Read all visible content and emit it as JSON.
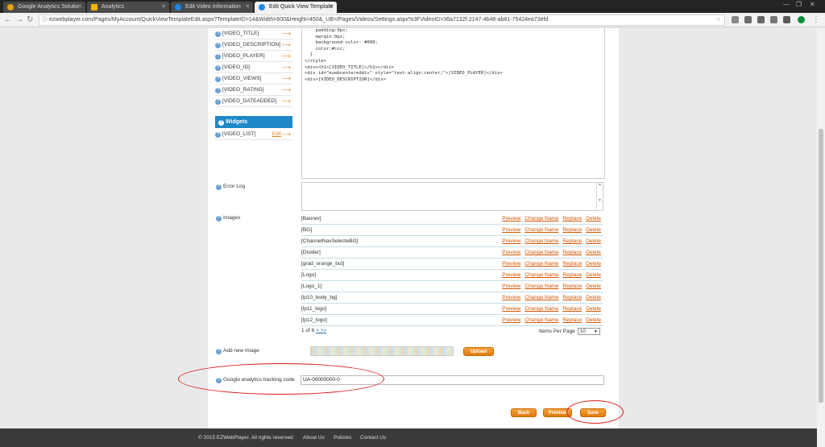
{
  "browser": {
    "tabs": [
      {
        "title": "Google Analytics Solutio",
        "color": "#e8a317"
      },
      {
        "title": "Analytics",
        "color": "#f4b400"
      },
      {
        "title": "Edit Video Information",
        "color": "#1e88e5"
      },
      {
        "title": "Edit Quick View Template",
        "color": "#1e88e5"
      }
    ],
    "url": "ezwebplayer.com/Pages/MyAccount/QuickViewTemplateEdit.aspx?TemplateID=14&Width=600&Height=450&_UB=/Pages/Videos/Settings.aspx%3FVideoID=36a7132f-2147-4b48-ab81-75424ea73efd"
  },
  "fields": [
    "[VIDEO_TITLE]",
    "[VIDEO_DESCRIPTION]",
    "[VIDEO_PLAYER]",
    "[VIDEO_ID]",
    "[VIDEO_VIEWS]",
    "[VIDEO_RATING]",
    "[VIDEO_DATEADDED]"
  ],
  "widgets": {
    "header": "Widgets",
    "item": "[VIDEO_LIST]",
    "edit": "Edit"
  },
  "code": "    padding:0px;\n    margin:0px;\n    background-color: #000;\n    color:#ccc;\n  }\n</style>\n<div><h1>[VIDEO_TITLE]</h1></div>\n<div id=\"ezwbcentereddiv\" style=\"text-align:center;\">[VIDEO_PLAYER]</div>\n<div>[VIDEO_DESCRIPTION]</div>",
  "labels": {
    "error_log": "Error Log",
    "images": "Images",
    "add_new_image": "Add new image",
    "ga_code": "Google analytics tracking code"
  },
  "images": [
    "[Banner]",
    "[BG]",
    "[ChannelNavSelecteBG]",
    "[Divider]",
    "[grad_orange_but]",
    "[Logo]",
    "[Logo_1]",
    "[lp10_body_bg]",
    "[lp11_logo]",
    "[lp12_logo]"
  ],
  "image_actions": [
    "Preview",
    "Change Name",
    "Replace",
    "Delete"
  ],
  "pager": {
    "text": "1 of 6",
    "next": "> >>",
    "items_per_page_label": "Items Per Page",
    "items_per_page": "10"
  },
  "buttons": {
    "upload": "Upload",
    "back": "Back",
    "preview": "Preview",
    "save": "Save"
  },
  "ga_value": "UA-00000000-0",
  "footer": {
    "copyright": "© 2015 EZWebPlayer. All rights reserved",
    "about": "About Us",
    "policies": "Policies",
    "contact": "Contact Us"
  }
}
